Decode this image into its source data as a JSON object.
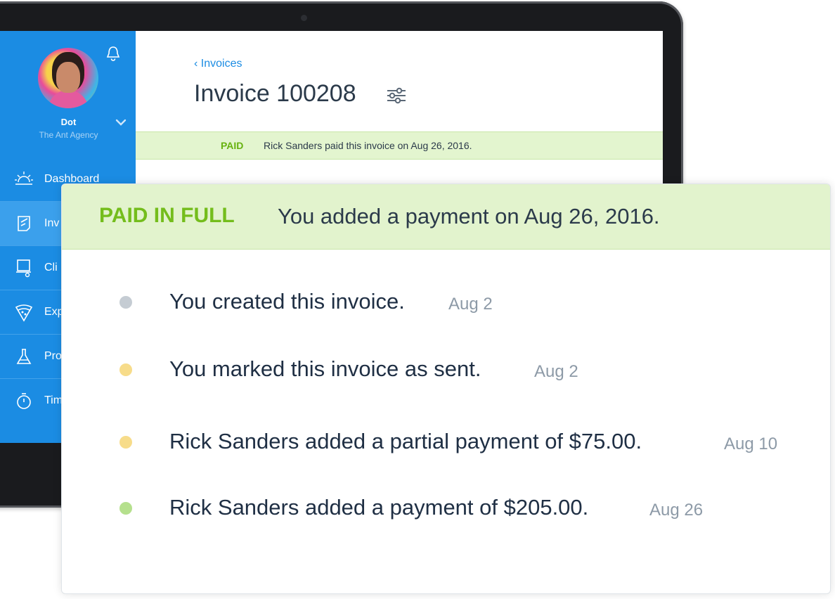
{
  "sidebar": {
    "user": {
      "name": "Dot",
      "agency": "The Ant Agency"
    },
    "items": [
      {
        "label": "Dashboard",
        "icon": "sun-icon"
      },
      {
        "label": "Inv",
        "icon": "invoice-icon"
      },
      {
        "label": "Cli",
        "icon": "clients-icon"
      },
      {
        "label": "Exp",
        "icon": "expenses-icon"
      },
      {
        "label": "Pro",
        "icon": "projects-icon"
      },
      {
        "label": "Tim",
        "icon": "timer-icon"
      }
    ]
  },
  "header": {
    "back_label": "Invoices",
    "title": "Invoice 100208"
  },
  "status_banner": {
    "tag": "PAID",
    "text": "Rick Sanders paid this invoice on Aug 26, 2016."
  },
  "activity": {
    "tag": "PAID IN FULL",
    "headline": "You added a payment on Aug 26, 2016.",
    "events": [
      {
        "text": "You created this invoice.",
        "date": "Aug 2",
        "color": "#c5ccd3"
      },
      {
        "text": "You marked this invoice as sent.",
        "date": "Aug 2",
        "color": "#f7dc8a"
      },
      {
        "text": "Rick Sanders added a partial payment of $75.00.",
        "date": "Aug 10",
        "color": "#f7dc8a"
      },
      {
        "text": "Rick Sanders added a payment of $205.00.",
        "date": "Aug 26",
        "color": "#b5e08d"
      }
    ]
  },
  "colors": {
    "brand_blue": "#1b8ce3",
    "paid_green": "#74bd1c",
    "banner_green": "#e2f3cd"
  }
}
